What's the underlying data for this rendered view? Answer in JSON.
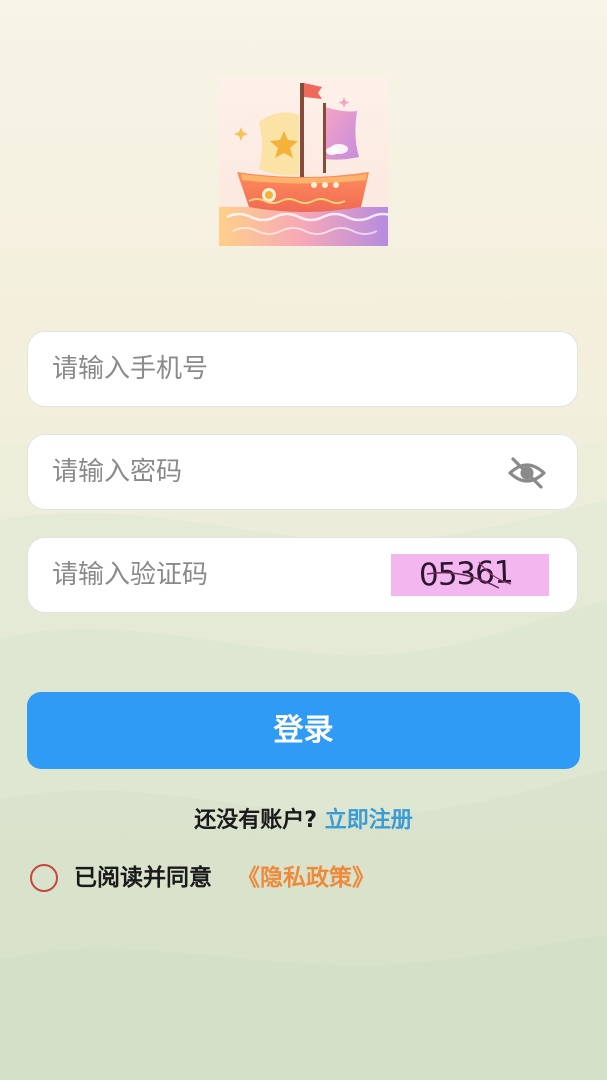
{
  "logo": {
    "name": "sailboat-logo"
  },
  "form": {
    "phone_placeholder": "请输入手机号",
    "password_placeholder": "请输入密码",
    "code_placeholder": "请输入验证码",
    "captcha_text": "05361"
  },
  "login_button": "登录",
  "register": {
    "question": "还没有账户?",
    "link": "立即注册"
  },
  "agreement": {
    "text": "已阅读并同意",
    "policy_link": "《隐私政策》",
    "checked": false
  },
  "colors": {
    "primary": "#2f9bf5",
    "link": "#3a9bd5",
    "policy": "#ee8a3c",
    "radio": "#c4463d",
    "captcha_bg": "#f4b6ef"
  },
  "icons": {
    "password_toggle": "eye-slash-icon"
  }
}
